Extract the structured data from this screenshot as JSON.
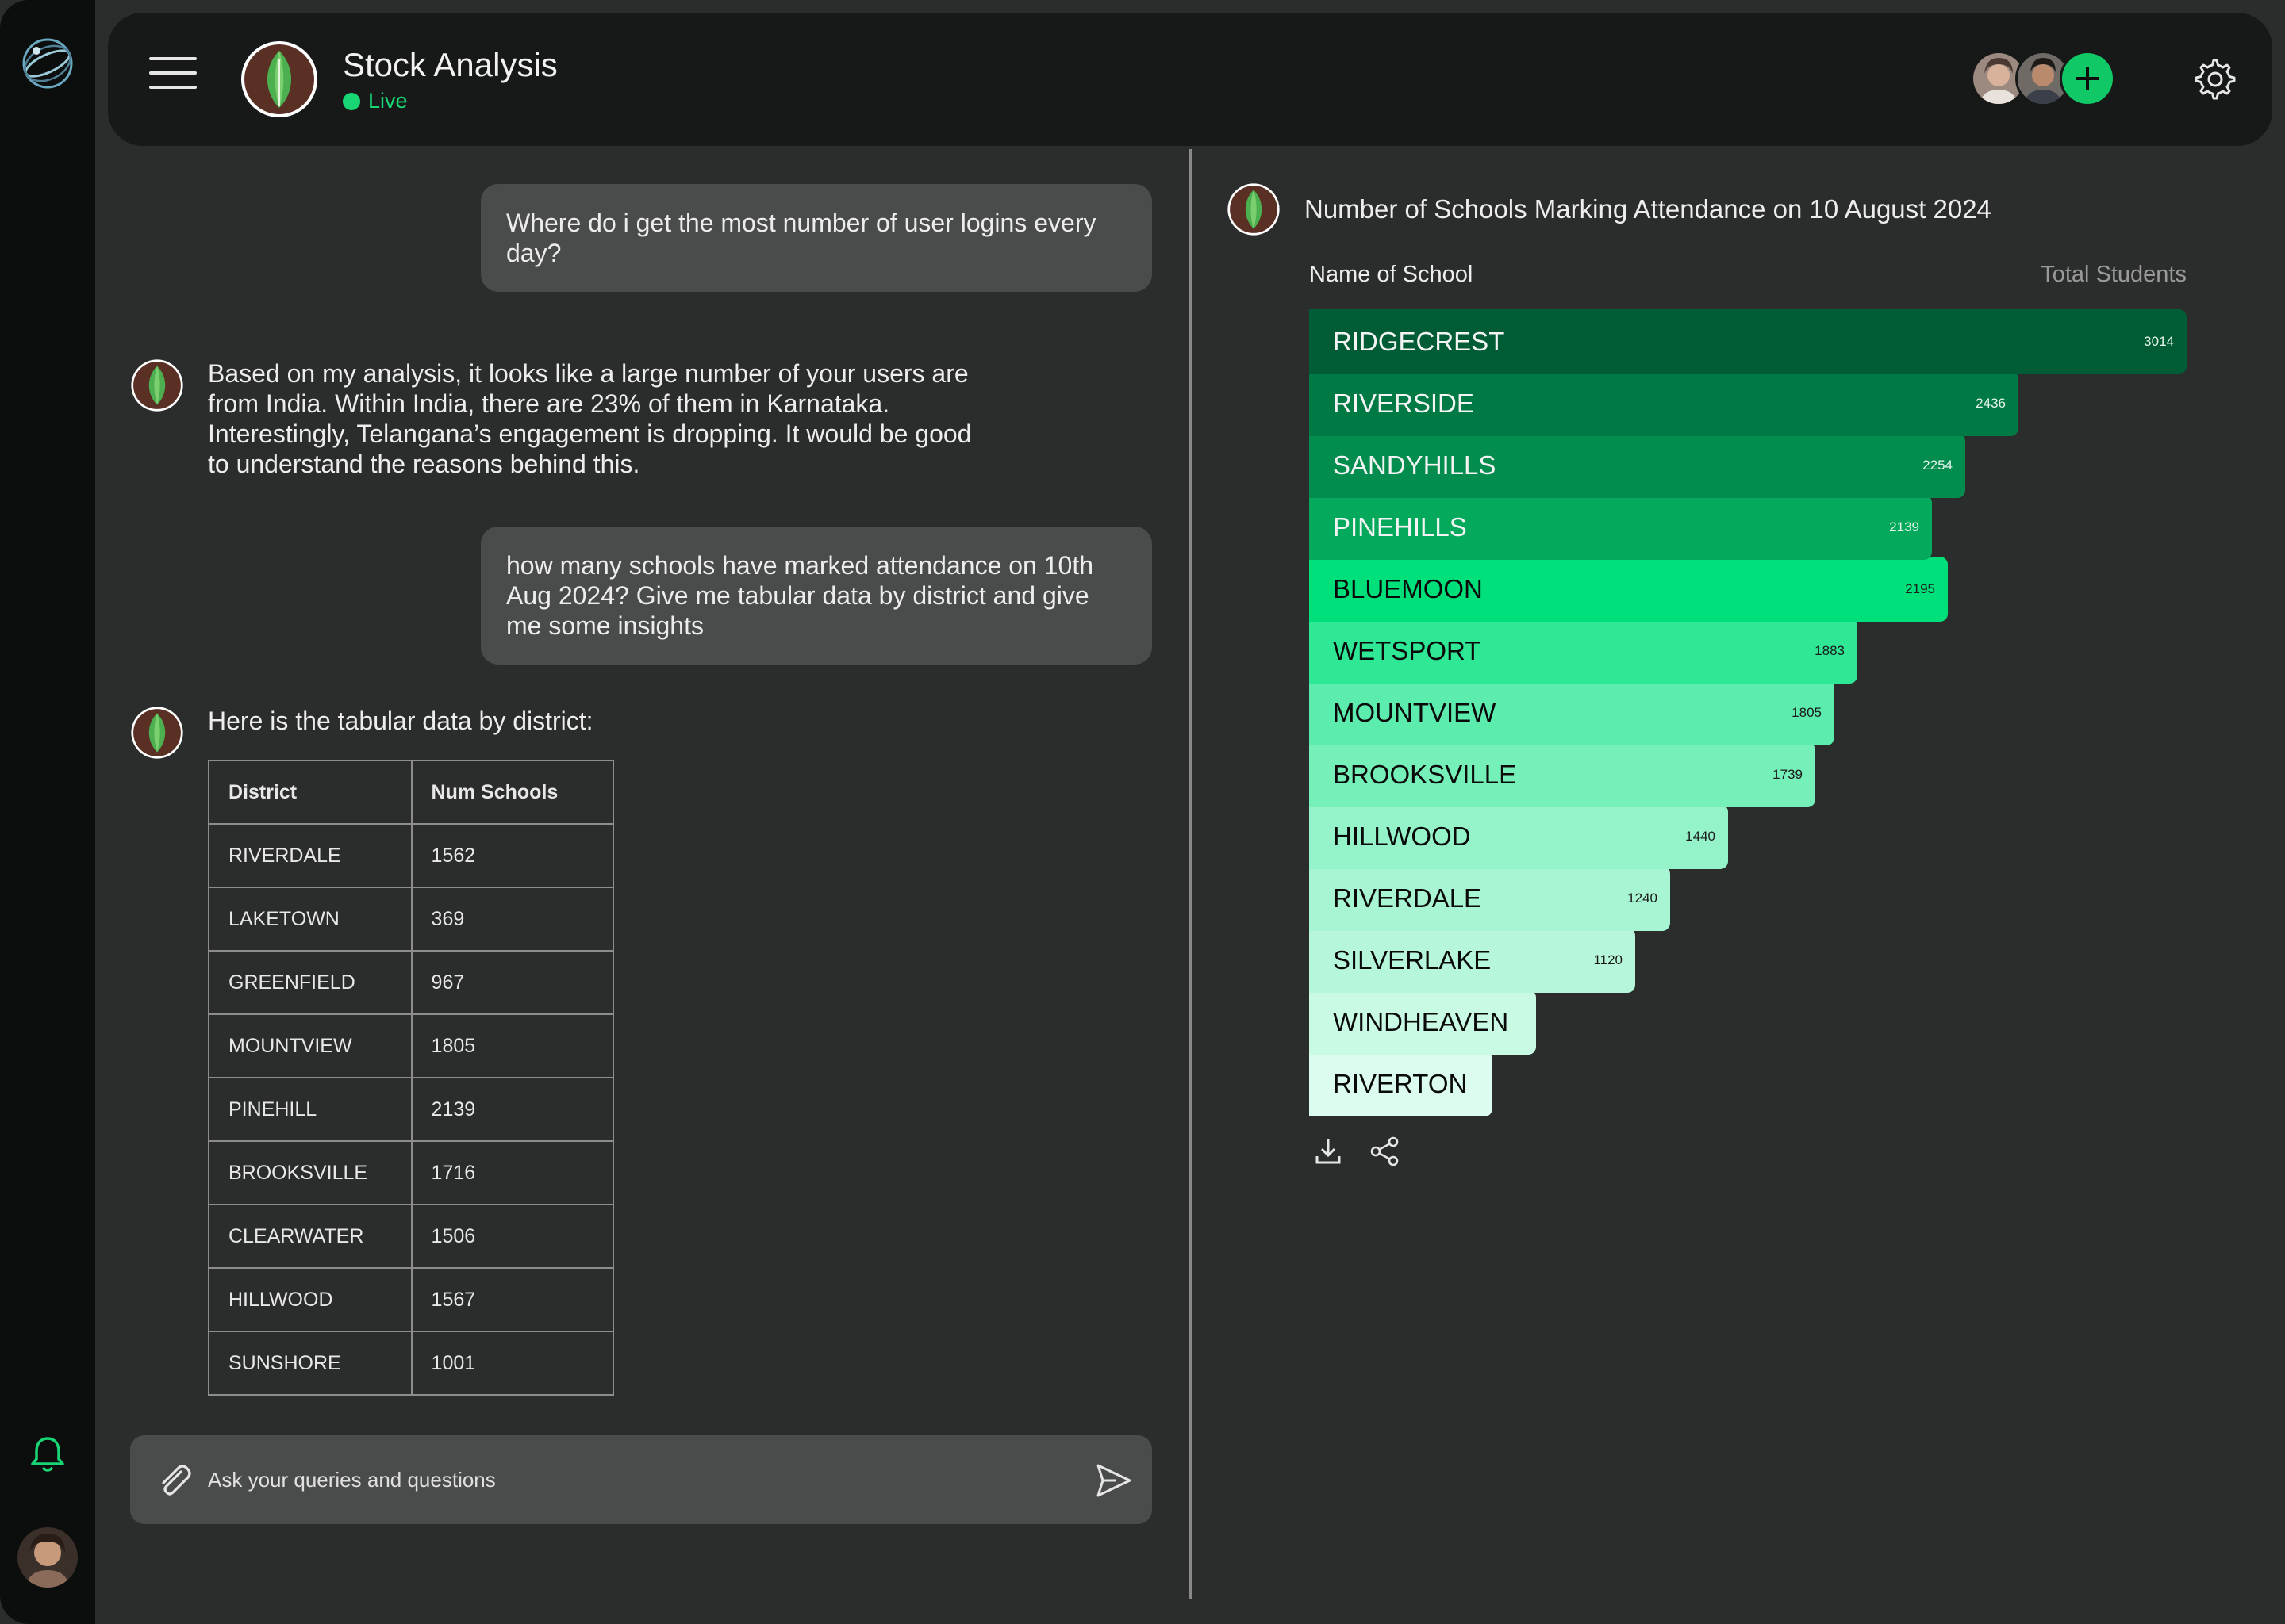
{
  "header": {
    "title": "Stock Analysis",
    "status": "Live"
  },
  "icons": {
    "rail_logo": "globe-logo-icon",
    "bell": "bell-icon",
    "menu": "hamburger-menu-icon",
    "brand": "leaf-logo-icon",
    "add": "plus-icon",
    "settings": "gear-icon",
    "attach": "paperclip-icon",
    "send": "send-icon",
    "download": "download-icon",
    "share": "share-icon"
  },
  "colors": {
    "accent": "#10c865",
    "live": "#19d675",
    "panel": "#171818",
    "bg": "#2b2c2c"
  },
  "chat": {
    "messages": [
      {
        "role": "user",
        "text": "Where do i get the most number of user logins every day?"
      },
      {
        "role": "assistant",
        "text": "Based on my analysis, it looks like a large number of your users are from India. Within India, there are 23% of them in Karnataka. Interestingly, Telangana’s engagement is dropping. It would be good to understand the reasons behind this."
      },
      {
        "role": "user",
        "text": "how many schools have marked attendance on 10th Aug 2024? Give me tabular data by district and give me some insights"
      },
      {
        "role": "assistant",
        "text": "Here is the tabular data by district:"
      }
    ],
    "table": {
      "headers": [
        "District",
        "Num Schools"
      ],
      "rows": [
        [
          "RIVERDALE",
          "1562"
        ],
        [
          "LAKETOWN",
          "369"
        ],
        [
          "GREENFIELD",
          "967"
        ],
        [
          "MOUNTVIEW",
          "1805"
        ],
        [
          "PINEHILL",
          "2139"
        ],
        [
          "BROOKSVILLE",
          "1716"
        ],
        [
          "CLEARWATER",
          "1506"
        ],
        [
          "HILLWOOD",
          "1567"
        ],
        [
          "SUNSHORE",
          "1001"
        ]
      ]
    }
  },
  "composer": {
    "placeholder": "Ask your queries and questions"
  },
  "chart_data": {
    "type": "bar",
    "orientation": "horizontal",
    "title": "Number of Schools Marking Attendance on 10 August 2024",
    "xlabel": "Total Students",
    "ylabel": "Name of School",
    "categories": [
      "RIDGECREST",
      "RIVERSIDE",
      "SANDYHILLS",
      "PINEHILLS",
      "BLUEMOON",
      "WETSPORT",
      "MOUNTVIEW",
      "BROOKSVILLE",
      "HILLWOOD",
      "RIVERDALE",
      "SILVERLAKE",
      "WINDHEAVEN",
      "RIVERTON"
    ],
    "values": [
      3014,
      2436,
      2254,
      2139,
      2195,
      1883,
      1805,
      1739,
      1440,
      1240,
      1120,
      780,
      630
    ],
    "value_labels": [
      "3014",
      "2436",
      "2254",
      "2139",
      "2195",
      "1883",
      "1805",
      "1739",
      "1440",
      "1240",
      "1120",
      "",
      ""
    ],
    "colors": [
      "#005c35",
      "#007a45",
      "#028d4e",
      "#04a95c",
      "#00e07a",
      "#2ee896",
      "#5ced ae",
      "#75f0b8",
      "#94f3c9",
      "#a7f5d2",
      "#b6f7db",
      "#c8fae4",
      "#dbfcee"
    ],
    "grid": false,
    "legend": "none"
  }
}
